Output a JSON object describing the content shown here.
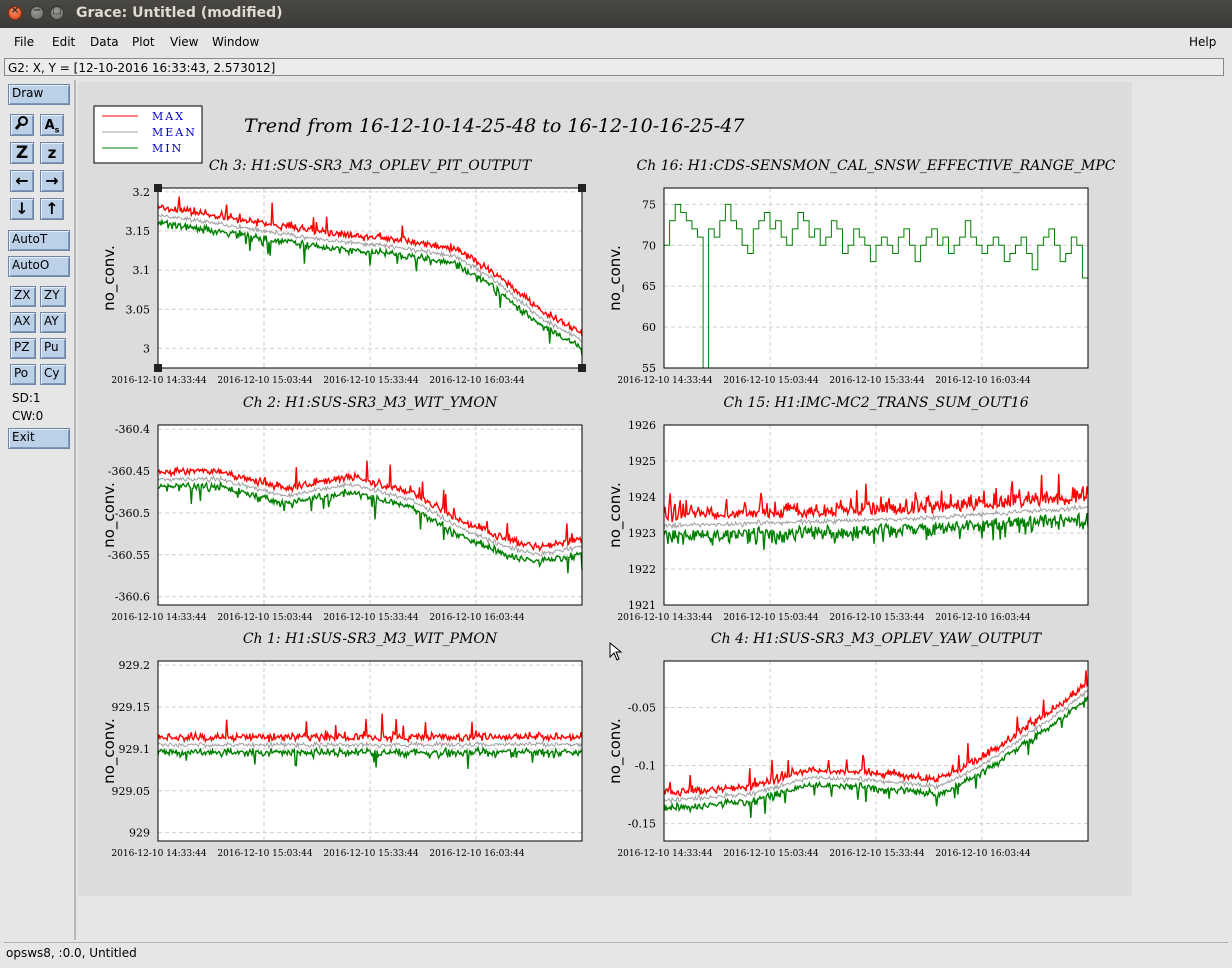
{
  "window": {
    "title": "Grace: Untitled (modified)",
    "close_glyph": "×",
    "min_glyph": "−",
    "max_glyph": "□"
  },
  "menubar": {
    "items": [
      {
        "label": "File"
      },
      {
        "label": "Edit"
      },
      {
        "label": "Data"
      },
      {
        "label": "Plot"
      },
      {
        "label": "View"
      },
      {
        "label": "Window"
      }
    ],
    "help": "Help"
  },
  "locator": "G2: X, Y = [12-10-2016 16:33:43, 2.573012]",
  "toolbar": {
    "draw": "Draw",
    "icons": [
      {
        "name": "zoom-icon",
        "glyph": "🔍"
      },
      {
        "name": "text-icon",
        "glyph": "A"
      },
      {
        "name": "zoom-z-icon",
        "glyph": "Z"
      },
      {
        "name": "zoom-small-z-icon",
        "glyph": "z"
      },
      {
        "name": "arrow-left-icon",
        "glyph": "←"
      },
      {
        "name": "arrow-right-icon",
        "glyph": "→"
      },
      {
        "name": "arrow-down-icon",
        "glyph": "↓"
      },
      {
        "name": "arrow-up-icon",
        "glyph": "↑"
      }
    ],
    "autot": "AutoT",
    "autoo": "AutoO",
    "small": [
      "ZX",
      "ZY",
      "AX",
      "AY",
      "PZ",
      "Pu",
      "Po",
      "Cy"
    ],
    "sd": "SD:1",
    "cw": "CW:0",
    "exit": "Exit"
  },
  "status": "opsws8, :0.0, Untitled",
  "page_title": "Trend from 16-12-10-14-25-48 to 16-12-10-16-25-47",
  "legend": [
    {
      "label": "MAX",
      "color": "#ff0000"
    },
    {
      "label": "MEAN",
      "color": "#a0a0a0"
    },
    {
      "label": "MIN",
      "color": "#008000"
    }
  ],
  "chart_data": [
    {
      "type": "line",
      "title": "Ch 3: H1:SUS-SR3_M3_OPLEV_PIT_OUTPUT",
      "ylabel": "no_conv.",
      "ylim": [
        2.975,
        3.205
      ],
      "yticks": [
        "3.2",
        "3.15",
        "3.1",
        "3.05",
        "3"
      ],
      "ytick_values": [
        3.2,
        3.15,
        3.1,
        3.05,
        3.0
      ],
      "xticks": [
        "2016-12-10 14:33:44",
        "2016-12-10 15:03:44",
        "2016-12-10 15:33:44",
        "2016-12-10 16:03:44"
      ],
      "series_names": [
        "MAX",
        "MEAN",
        "MIN"
      ],
      "style": "band",
      "selected": true,
      "trend": [
        [
          0,
          3.17
        ],
        [
          0.1,
          3.163
        ],
        [
          0.25,
          3.15
        ],
        [
          0.4,
          3.138
        ],
        [
          0.55,
          3.13
        ],
        [
          0.7,
          3.118
        ],
        [
          0.8,
          3.085
        ],
        [
          0.9,
          3.04
        ],
        [
          1.0,
          3.01
        ]
      ]
    },
    {
      "type": "line",
      "title": "Ch 16: H1:CDS-SENSMON_CAL_SNSW_EFFECTIVE_RANGE_MPC",
      "ylabel": "no_conv.",
      "ylim": [
        55,
        77
      ],
      "yticks": [
        "75",
        "70",
        "65",
        "60",
        "55"
      ],
      "ytick_values": [
        75,
        70,
        65,
        60,
        55
      ],
      "xticks": [
        "2016-12-10 14:33:44",
        "2016-12-10 15:03:44",
        "2016-12-10 15:33:44",
        "2016-12-10 16:03:44"
      ],
      "series_names": [
        "MIN"
      ],
      "style": "step",
      "values": [
        70,
        73,
        75,
        74,
        73,
        72,
        71,
        55,
        72,
        71,
        73,
        75,
        73,
        72,
        70,
        69,
        72,
        73,
        74,
        72,
        73,
        71,
        70,
        72,
        74,
        73,
        71,
        72,
        70,
        71,
        73,
        72,
        69,
        70,
        72,
        71,
        70,
        68,
        70,
        71,
        70,
        69,
        71,
        72,
        70,
        68,
        70,
        71,
        72,
        70,
        71,
        69,
        70,
        71,
        73,
        71,
        70,
        69,
        70,
        71,
        70,
        68,
        69,
        70,
        71,
        69,
        67,
        70,
        71,
        72,
        70,
        68,
        69,
        71,
        70,
        66
      ]
    },
    {
      "type": "line",
      "title": "Ch 2: H1:SUS-SR3_M3_WIT_YMON",
      "ylabel": "no_conv.",
      "ylim": [
        -360.61,
        -360.395
      ],
      "yticks": [
        "-360.4",
        "-360.45",
        "-360.5",
        "-360.55",
        "-360.6"
      ],
      "ytick_values": [
        -360.4,
        -360.45,
        -360.5,
        -360.55,
        -360.6
      ],
      "xticks": [
        "2016-12-10 14:33:44",
        "2016-12-10 15:03:44",
        "2016-12-10 15:33:44",
        "2016-12-10 16:03:44"
      ],
      "series_names": [
        "MAX",
        "MEAN",
        "MIN"
      ],
      "style": "band",
      "trend": [
        [
          0,
          -360.46
        ],
        [
          0.15,
          -360.46
        ],
        [
          0.3,
          -360.48
        ],
        [
          0.45,
          -360.465
        ],
        [
          0.6,
          -360.485
        ],
        [
          0.72,
          -360.52
        ],
        [
          0.82,
          -360.54
        ],
        [
          0.9,
          -360.55
        ],
        [
          1.0,
          -360.54
        ]
      ]
    },
    {
      "type": "line",
      "title": "Ch 15: H1:IMC-MC2_TRANS_SUM_OUT16",
      "ylabel": "no_conv.",
      "ylim": [
        1921,
        1926
      ],
      "yticks": [
        "1926",
        "1925",
        "1924",
        "1923",
        "1922",
        "1921"
      ],
      "ytick_values": [
        1926,
        1925,
        1924,
        1923,
        1922,
        1921
      ],
      "xticks": [
        "2016-12-10 14:33:44",
        "2016-12-10 15:03:44",
        "2016-12-10 15:33:44",
        "2016-12-10 16:03:44"
      ],
      "series_names": [
        "MAX",
        "MEAN",
        "MIN"
      ],
      "style": "noise",
      "trend": [
        [
          0,
          1923.2
        ],
        [
          0.3,
          1923.3
        ],
        [
          0.6,
          1923.4
        ],
        [
          0.85,
          1923.6
        ],
        [
          1.0,
          1923.7
        ]
      ]
    },
    {
      "type": "line",
      "title": "Ch 1: H1:SUS-SR3_M3_WIT_PMON",
      "ylabel": "no_conv.",
      "ylim": [
        928.99,
        929.205
      ],
      "yticks": [
        "929.2",
        "929.15",
        "929.1",
        "929.05",
        "929"
      ],
      "ytick_values": [
        929.2,
        929.15,
        929.1,
        929.05,
        929.0
      ],
      "xticks": [
        "2016-12-10 14:33:44",
        "2016-12-10 15:03:44",
        "2016-12-10 15:33:44",
        "2016-12-10 16:03:44"
      ],
      "series_names": [
        "MAX",
        "MEAN",
        "MIN"
      ],
      "style": "band",
      "trend": [
        [
          0,
          929.105
        ],
        [
          0.5,
          929.105
        ],
        [
          1.0,
          929.105
        ]
      ]
    },
    {
      "type": "line",
      "title": "Ch 4: H1:SUS-SR3_M3_OPLEV_YAW_OUTPUT",
      "ylabel": "no_conv.",
      "ylim": [
        -0.165,
        -0.01
      ],
      "yticks": [
        "-0.05",
        "-0.1",
        "-0.15"
      ],
      "ytick_values": [
        -0.05,
        -0.1,
        -0.15
      ],
      "xticks": [
        "2016-12-10 14:33:44",
        "2016-12-10 15:03:44",
        "2016-12-10 15:33:44",
        "2016-12-10 16:03:44"
      ],
      "series_names": [
        "MAX",
        "MEAN",
        "MIN"
      ],
      "style": "band",
      "trend": [
        [
          0,
          -0.13
        ],
        [
          0.2,
          -0.125
        ],
        [
          0.35,
          -0.11
        ],
        [
          0.5,
          -0.113
        ],
        [
          0.65,
          -0.118
        ],
        [
          0.75,
          -0.1
        ],
        [
          0.85,
          -0.075
        ],
        [
          0.95,
          -0.05
        ],
        [
          1.0,
          -0.035
        ]
      ]
    }
  ]
}
